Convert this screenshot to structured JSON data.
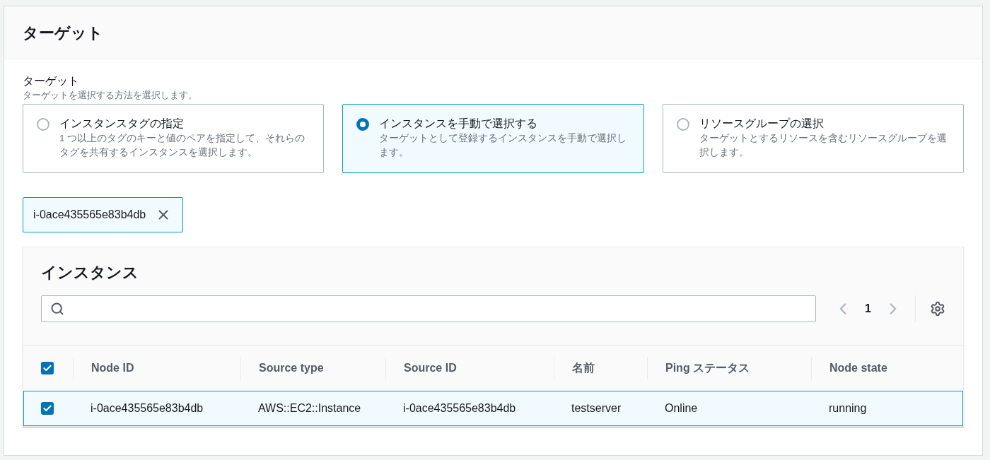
{
  "panel": {
    "title": "ターゲット"
  },
  "field": {
    "label": "ターゲット",
    "description": "ターゲットを選択する方法を選択します。"
  },
  "options": [
    {
      "title": "インスタンスタグの指定",
      "description": "1 つ以上のタグのキーと値のペアを指定して、それらのタグを共有するインスタンスを選択します。",
      "selected": false
    },
    {
      "title": "インスタンスを手動で選択する",
      "description": "ターゲットとして登録するインスタンスを手動で選択します。",
      "selected": true
    },
    {
      "title": "リソースグループの選択",
      "description": "ターゲットとするリソースを含むリソースグループを選択します。",
      "selected": false
    }
  ],
  "tokens": [
    {
      "label": "i-0ace435565e83b4db"
    }
  ],
  "instances": {
    "title": "インスタンス",
    "page": "1",
    "all_checked": true,
    "columns": [
      "Node ID",
      "Source type",
      "Source ID",
      "名前",
      "Ping ステータス",
      "Node state"
    ],
    "rows": [
      {
        "cells": [
          "i-0ace435565e83b4db",
          "AWS::EC2::Instance",
          "i-0ace435565e83b4db",
          "testserver",
          "Online",
          "running"
        ],
        "selected": true
      }
    ]
  }
}
